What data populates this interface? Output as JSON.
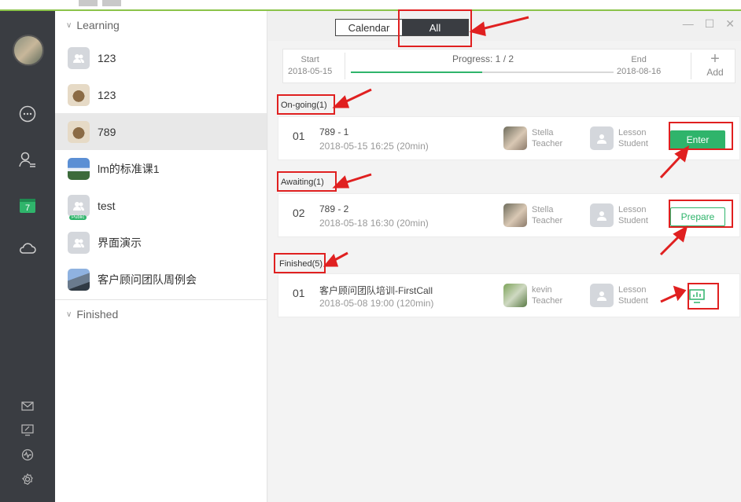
{
  "window_controls": {
    "minimize": "—",
    "maximize": "☐",
    "close": "✕"
  },
  "view_toggle": {
    "calendar": "Calendar",
    "all": "All"
  },
  "sidebar": {
    "learning_header": "Learning",
    "finished_header": "Finished",
    "courses": [
      {
        "name": "123",
        "icon": "people-icon"
      },
      {
        "name": "123",
        "icon": "bear-icon"
      },
      {
        "name": "789",
        "icon": "bear-icon"
      },
      {
        "name": "lm的标准课1",
        "icon": "landscape-icon"
      },
      {
        "name": "test",
        "icon": "people-icon",
        "badge": "Public"
      },
      {
        "name": "界面演示",
        "icon": "people-icon"
      },
      {
        "name": "客户顾问团队周例会",
        "icon": "road-icon"
      }
    ]
  },
  "progress": {
    "start_label": "Start",
    "start_date": "2018-05-15",
    "progress_text": "Progress: 1 / 2",
    "progress_fraction": 0.5,
    "end_label": "End",
    "end_date": "2018-08-16",
    "add_symbol": "+",
    "add_label": "Add"
  },
  "sections": {
    "ongoing": "On-going(1)",
    "awaiting": "Awaiting(1)",
    "finished": "Finished(5)"
  },
  "lessons": [
    {
      "num": "01",
      "title": "789 - 1",
      "time": "2018-05-15 16:25 (20min)",
      "teacher_name": "Stella",
      "teacher_role": "Teacher",
      "student_name": "Lesson",
      "student_role": "Student",
      "action": "Enter"
    },
    {
      "num": "02",
      "title": "789 - 2",
      "time": "2018-05-18 16:30 (20min)",
      "teacher_name": "Stella",
      "teacher_role": "Teacher",
      "student_name": "Lesson",
      "student_role": "Student",
      "action": "Prepare"
    },
    {
      "num": "01",
      "title": "客户顾问团队培训-FirstCall",
      "time": "2018-05-08 19:00 (120min)",
      "teacher_name": "kevin",
      "teacher_role": "Teacher",
      "student_name": "Lesson",
      "student_role": "Student",
      "action": "report-icon"
    }
  ],
  "colors": {
    "accent": "#2fb46b",
    "rail": "#3a3d42",
    "highlight": "#e02020"
  }
}
